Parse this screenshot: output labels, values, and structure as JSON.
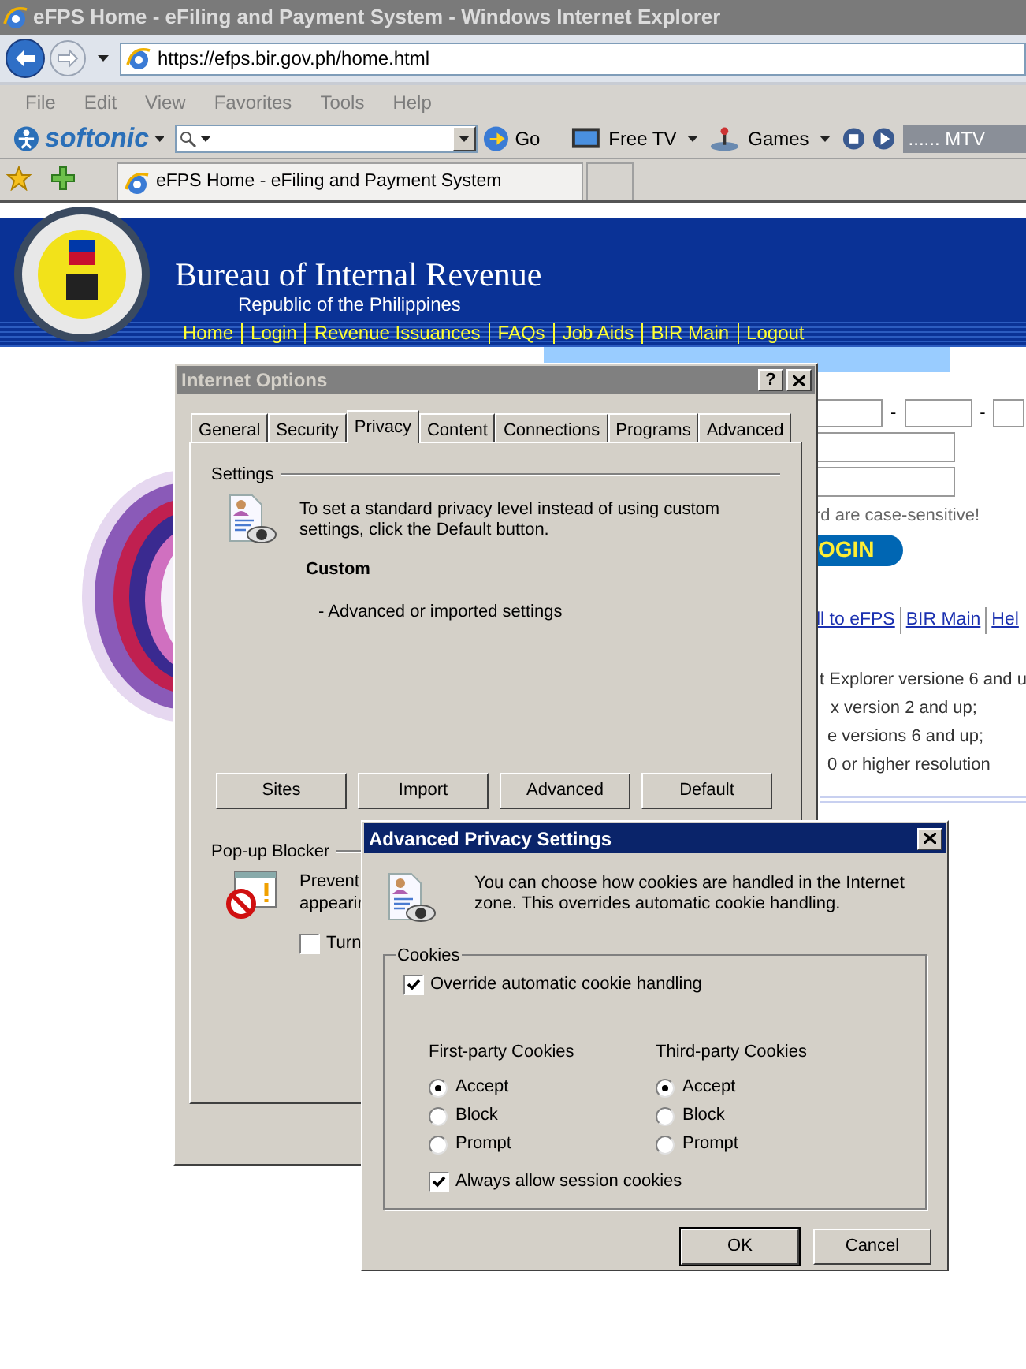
{
  "browser": {
    "title": "eFPS Home - eFiling and Payment System - Windows Internet Explorer",
    "address": "https://efps.bir.gov.ph/home.html",
    "menu": [
      "File",
      "Edit",
      "View",
      "Favorites",
      "Tools",
      "Help"
    ],
    "toolbar": {
      "brand": "softonic",
      "go": "Go",
      "free_tv": "Free TV",
      "games": "Games",
      "media": "...... MTV"
    },
    "tabs": [
      {
        "label": "eFPS Home - eFiling and Payment System",
        "selected": true
      }
    ]
  },
  "page": {
    "header": {
      "title": "Bureau of Internal Revenue",
      "subtitle": "Republic of the Philippines",
      "nav": [
        "Home",
        "Login",
        "Revenue Issuances",
        "FAQs",
        "Job Aids",
        "BIR Main",
        "Logout"
      ]
    },
    "dash_separators": [
      "-",
      "-"
    ],
    "notice": "rd are case-sensitive!",
    "login_button": "OGIN",
    "links": [
      "ll to eFPS",
      "BIR Main",
      "Hel"
    ],
    "requirements": [
      "t Explorer versione 6 and u",
      "x version 2 and up;",
      "e versions 6 and up;",
      "0 or higher resolution"
    ]
  },
  "internet_options": {
    "title": "Internet Options",
    "help": "?",
    "tabs": [
      {
        "label": "General",
        "selected": false
      },
      {
        "label": "Security",
        "selected": false
      },
      {
        "label": "Privacy",
        "selected": true
      },
      {
        "label": "Content",
        "selected": false
      },
      {
        "label": "Connections",
        "selected": false
      },
      {
        "label": "Programs",
        "selected": false
      },
      {
        "label": "Advanced",
        "selected": false
      }
    ],
    "settings_label": "Settings",
    "description": "To set a standard privacy level instead of using custom settings, click the Default button.",
    "level": "Custom",
    "level_detail": "- Advanced or imported settings",
    "buttons": [
      "Sites",
      "Import",
      "Advanced",
      "Default"
    ],
    "popup": {
      "label": "Pop-up Blocker",
      "lines": [
        "Prevent",
        "appearir"
      ],
      "checkbox": {
        "label": "Turn",
        "checked": false
      }
    }
  },
  "advanced_privacy": {
    "title": "Advanced Privacy Settings",
    "intro": "You can choose how cookies are handled in the Internet zone.  This overrides automatic cookie handling.",
    "group": "Cookies",
    "override": {
      "label": "Override automatic cookie handling",
      "checked": true
    },
    "columns": [
      {
        "heading": "First-party Cookies",
        "options": [
          {
            "label": "Accept",
            "selected": true
          },
          {
            "label": "Block",
            "selected": false
          },
          {
            "label": "Prompt",
            "selected": false
          }
        ]
      },
      {
        "heading": "Third-party Cookies",
        "options": [
          {
            "label": "Accept",
            "selected": true
          },
          {
            "label": "Block",
            "selected": false
          },
          {
            "label": "Prompt",
            "selected": false
          }
        ]
      }
    ],
    "session": {
      "label": "Always allow session cookies",
      "checked": true
    },
    "buttons": [
      "OK",
      "Cancel"
    ]
  }
}
